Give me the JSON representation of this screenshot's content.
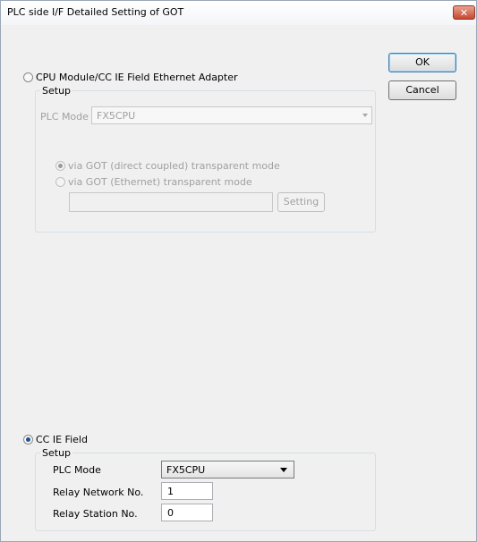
{
  "window": {
    "title": "PLC side I/F Detailed Setting of GOT",
    "close_glyph": "✕"
  },
  "buttons": {
    "ok": "OK",
    "cancel": "Cancel"
  },
  "cpu_section": {
    "radio_label": "CPU Module/CC IE Field Ethernet Adapter",
    "selected": false,
    "group_title": "Setup",
    "plc_mode_label": "PLC Mode",
    "plc_mode_value": "FX5CPU",
    "mode_direct_label": "via GOT (direct coupled) transparent mode",
    "mode_direct_selected": true,
    "mode_ethernet_label": "via GOT (Ethernet) transparent mode",
    "mode_ethernet_selected": false,
    "ethernet_value": "",
    "setting_button": "Setting"
  },
  "ccie_section": {
    "radio_label": "CC IE Field",
    "selected": true,
    "group_title": "Setup",
    "plc_mode_label": "PLC Mode",
    "plc_mode_value": "FX5CPU",
    "relay_network_label": "Relay Network No.",
    "relay_network_value": "1",
    "relay_station_label": "Relay Station No.",
    "relay_station_value": "0"
  }
}
